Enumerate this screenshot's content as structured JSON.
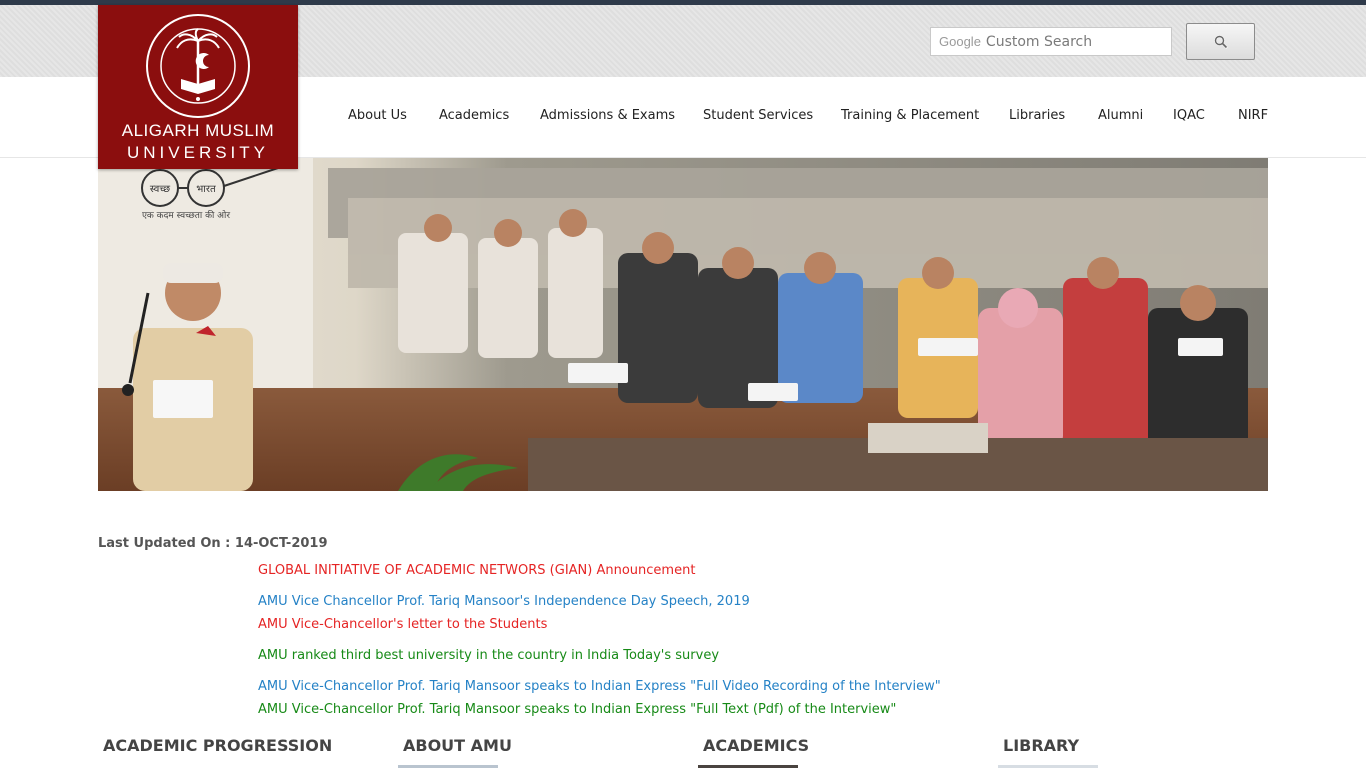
{
  "header": {
    "logo_line1": "ALIGARH MUSLIM",
    "logo_line2": "UNIVERSITY",
    "seal_text": "ALIGARH MUSLIM UNIVERSITY ALIGARH"
  },
  "search": {
    "brand": "Google",
    "placeholder": "Custom Search",
    "button_icon": "search-icon"
  },
  "nav": {
    "items": [
      "About Us",
      "Academics",
      "Admissions & Exams",
      "Student Services",
      "Training & Placement",
      "Libraries",
      "Alumni",
      "IQAC",
      "NIRF"
    ]
  },
  "hero": {
    "swachh_left": "स्वच्छ",
    "swachh_right": "भारत",
    "swachh_tagline": "एक कदम स्वच्छता की ओर"
  },
  "updates": {
    "label": "Last Updated On : 14-OCT-2019",
    "news": [
      {
        "text": "GLOBAL INITIATIVE OF ACADEMIC NETWORS (GIAN) Announcement",
        "color": "#e52424"
      },
      {
        "text": "AMU Vice Chancellor Prof. Tariq Mansoor's Independence Day Speech, 2019",
        "color": "#2582c6"
      },
      {
        "text": "AMU Vice-Chancellor's letter to the Students",
        "color": "#e52424"
      },
      {
        "text": "AMU ranked third best university in the country in India Today's survey",
        "color": "#178a17"
      },
      {
        "text": "AMU Vice-Chancellor Prof. Tariq Mansoor speaks to Indian Express \"Full Video Recording of the Interview\"",
        "color": "#2582c6"
      },
      {
        "text": "AMU Vice-Chancellor Prof. Tariq Mansoor speaks to Indian Express \"Full Text (Pdf) of the Interview\"",
        "color": "#178a17"
      }
    ]
  },
  "sections": [
    "ACADEMIC PROGRESSION",
    "ABOUT AMU",
    "ACADEMICS",
    "LIBRARY"
  ],
  "colors": {
    "logo_bg": "#8b0e0e",
    "link_red": "#e52424",
    "link_blue": "#2582c6",
    "link_green": "#178a17"
  }
}
